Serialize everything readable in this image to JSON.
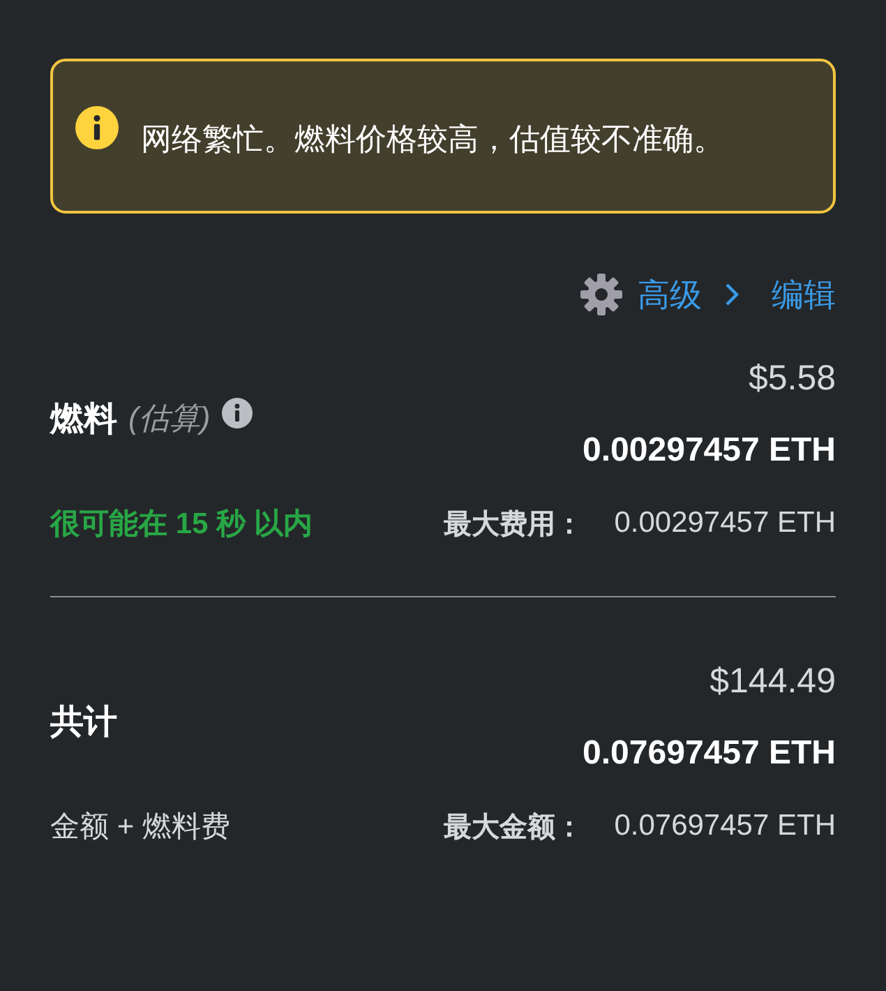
{
  "alert": {
    "message": "网络繁忙。燃料价格较高，估值较不准确。"
  },
  "advanced": {
    "label": "高级",
    "link": "编辑"
  },
  "sections": [
    {
      "kind": "fee",
      "title": "燃料",
      "hint": "(估算)",
      "fiat": "$5.58",
      "amount": "0.00297457 ETH",
      "note": "很可能在 15 秒 以内",
      "max_label": "最大费用：",
      "max_value": "0.00297457 ETH"
    },
    {
      "kind": "total",
      "title": "共计",
      "fiat": "$144.49",
      "amount": "0.07697457 ETH",
      "note": "金额 + 燃料费",
      "max_label": "最大金额：",
      "max_value": "0.07697457 ETH"
    }
  ]
}
